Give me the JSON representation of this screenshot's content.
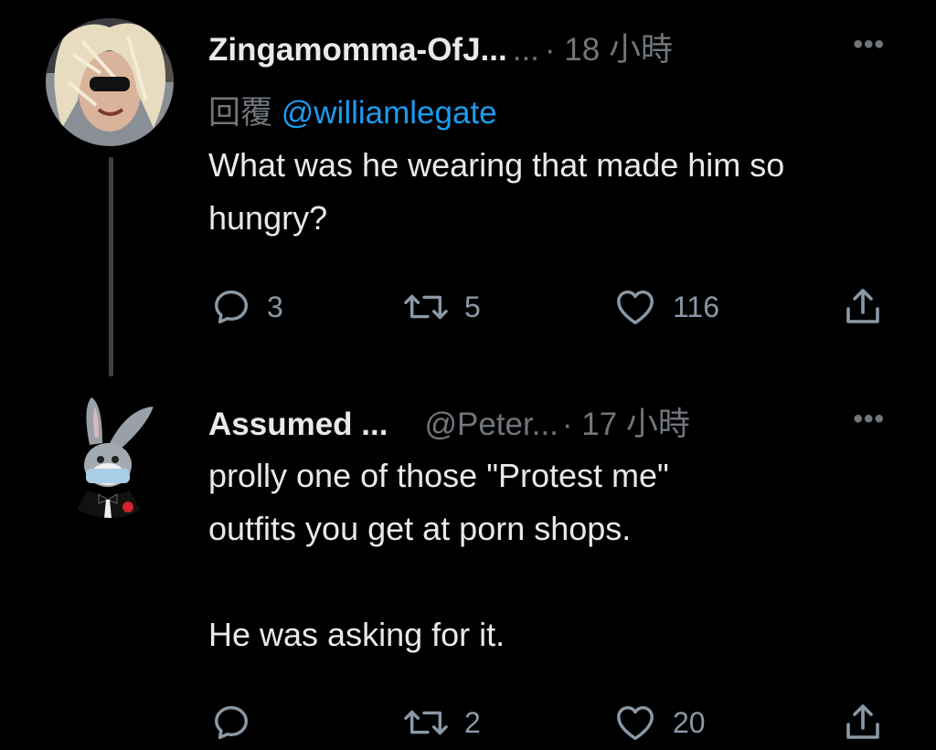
{
  "tweets": [
    {
      "display_name": "Zingamomma-OfJ...",
      "handle": " ...",
      "time": " · 18 小時",
      "more_label": "•••",
      "reply_label": "回覆",
      "reply_mention": "@williamlegate",
      "body": "What was he wearing that made him so hungry?",
      "stats": {
        "replies": "3",
        "retweets": "5",
        "likes": "116"
      }
    },
    {
      "display_name": "Assumed ...",
      "handle": "@Peter...",
      "time": " · 17 小時",
      "more_label": "•••",
      "body_line1": "prolly one of those \"Protest me\"",
      "body_line2": "outfits you get at porn shops.",
      "body_line3": "He was asking for it.",
      "stats": {
        "replies": "",
        "retweets": "2",
        "likes": "20"
      }
    }
  ],
  "colors": {
    "background": "#000000",
    "text_primary": "#e7e9ea",
    "text_secondary": "#71767b",
    "link": "#1d9bf0",
    "thread_line": "#3e4144"
  },
  "icons": {
    "reply": "speech-bubble-icon",
    "retweet": "retweet-arrows-icon",
    "like": "heart-icon",
    "share": "share-upload-icon",
    "more": "more-dots-icon"
  }
}
